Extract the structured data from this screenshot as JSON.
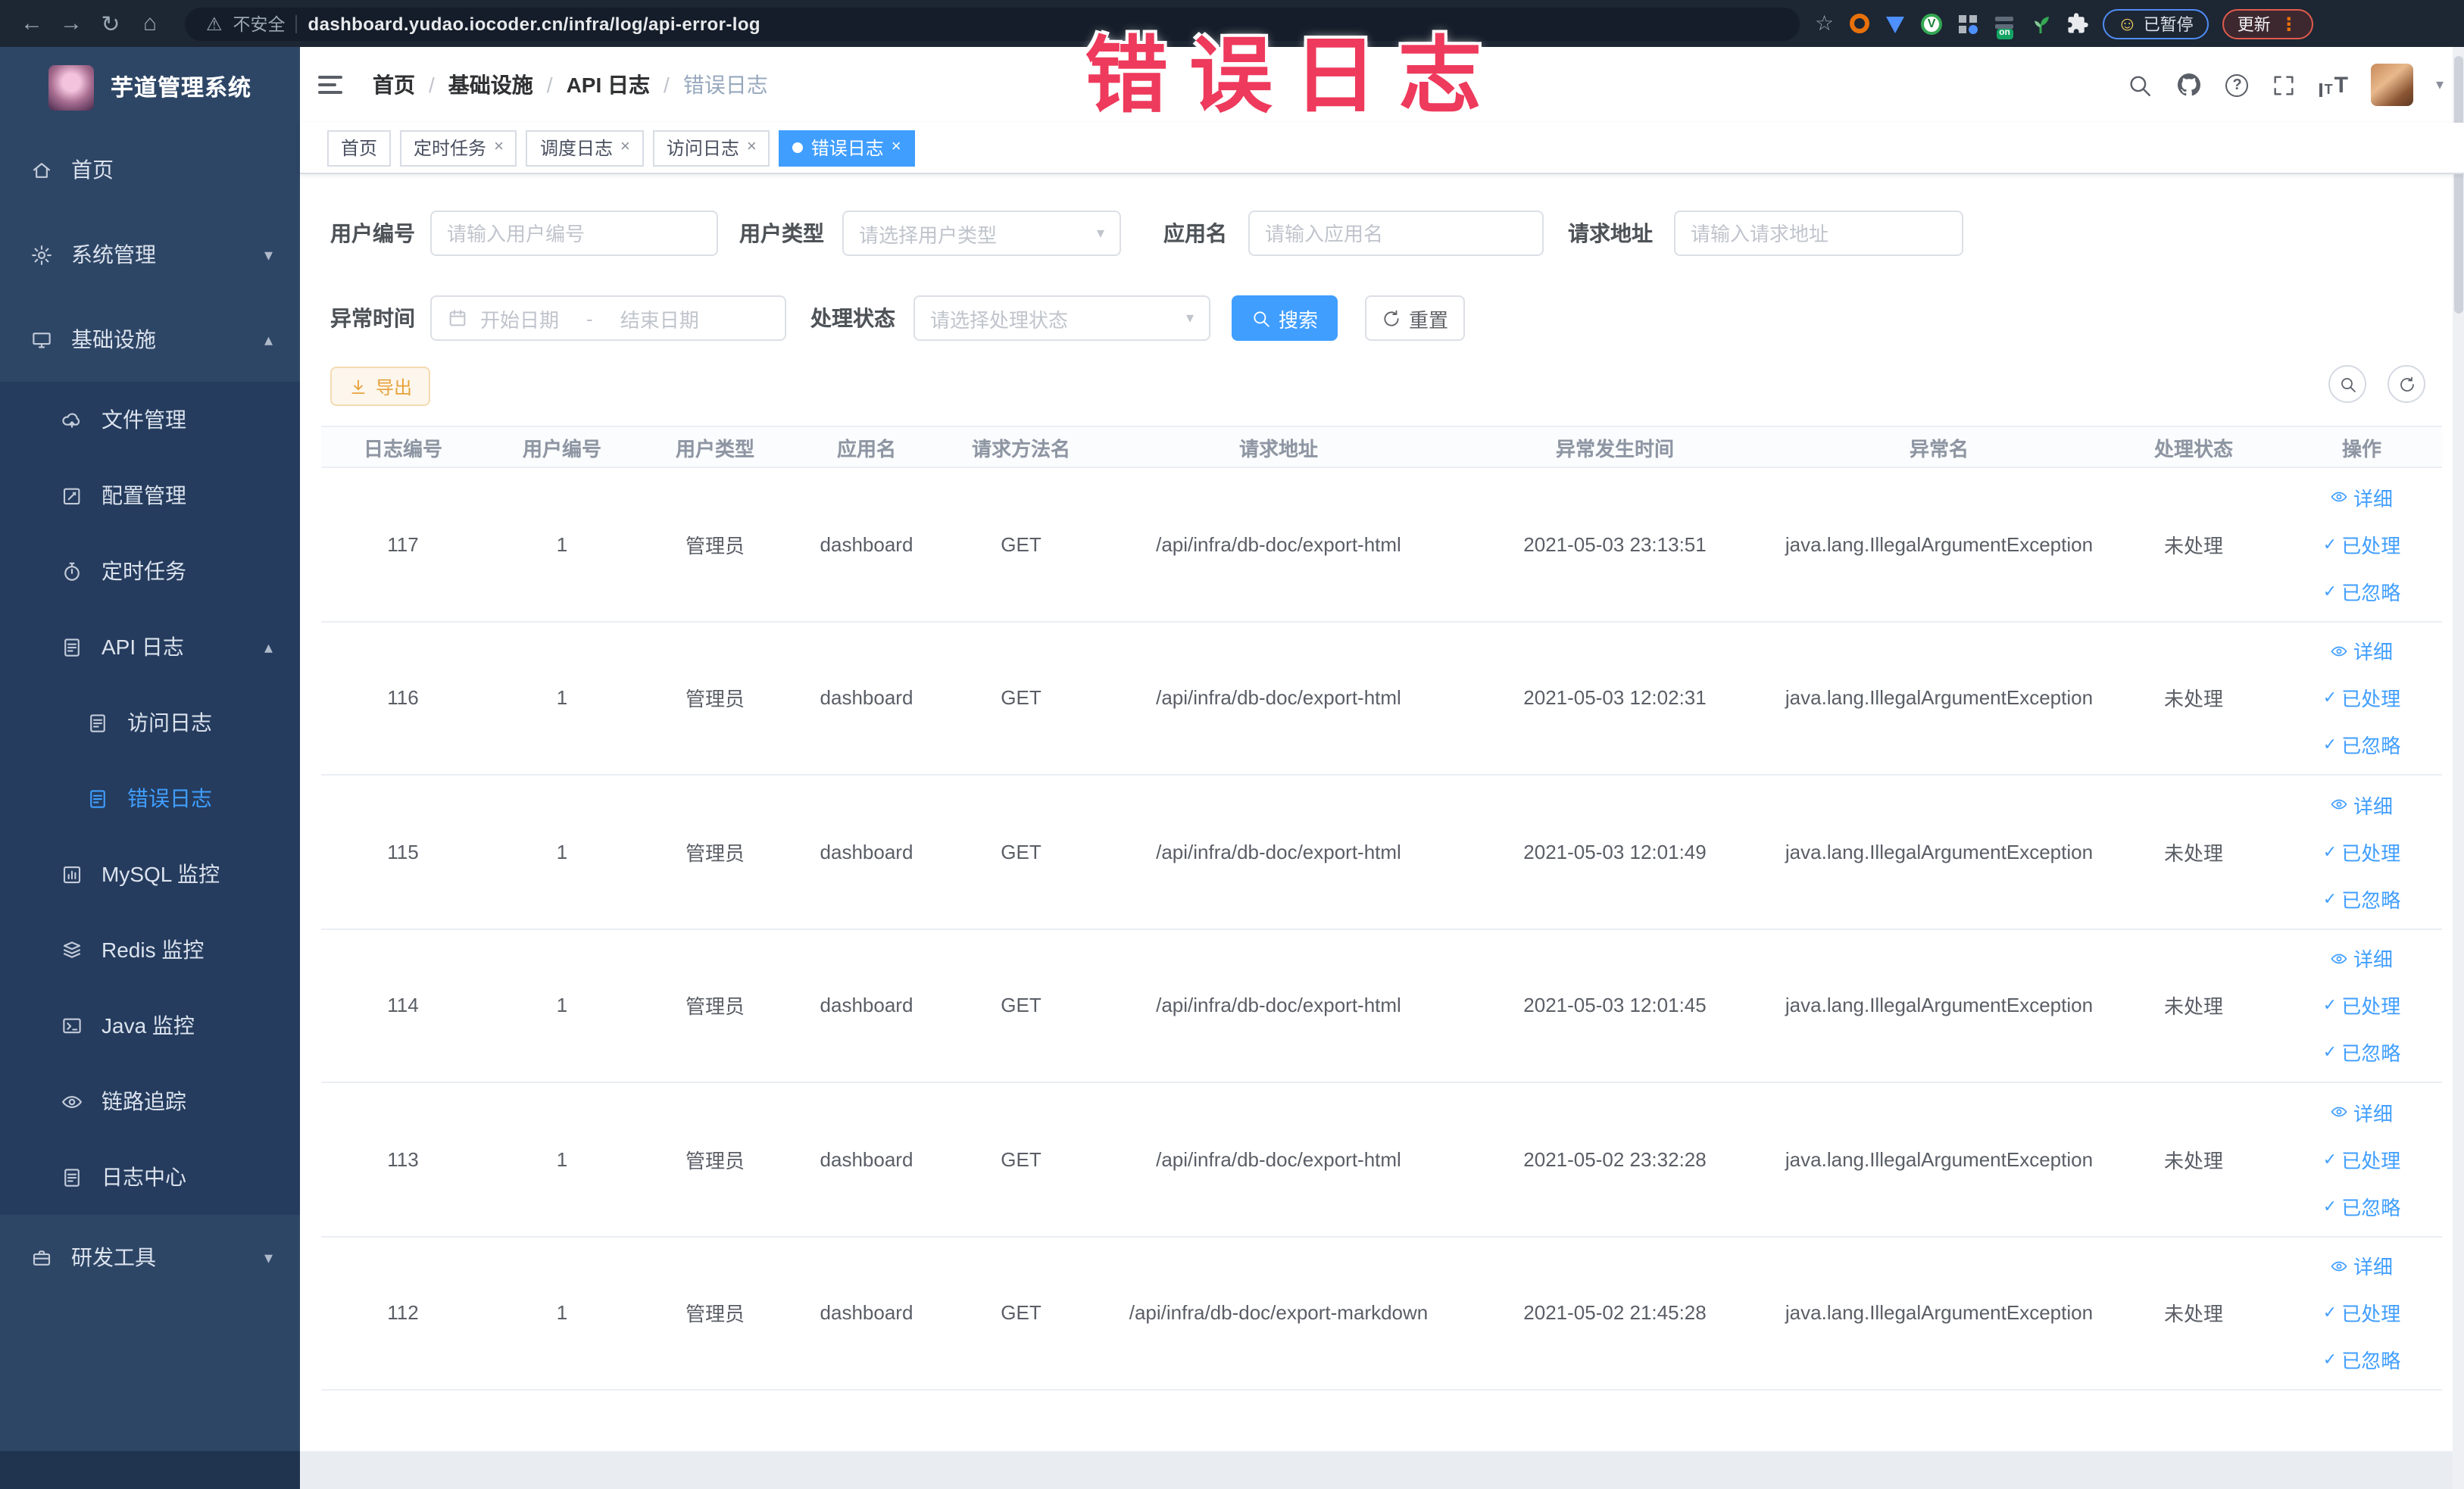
{
  "browser": {
    "security_label": "不安全",
    "url": "dashboard.yudao.iocoder.cn/infra/log/api-error-log",
    "paused_badge": "已暂停",
    "update_badge": "更新"
  },
  "overlay_title": "错误日志",
  "sidebar": {
    "title": "芋道管理系统",
    "menu": [
      {
        "label": "首页",
        "icon": "home",
        "level": 0,
        "sub": false,
        "active": false,
        "chevron": ""
      },
      {
        "label": "系统管理",
        "icon": "gear",
        "level": 0,
        "sub": false,
        "active": false,
        "chevron": "down"
      },
      {
        "label": "基础设施",
        "icon": "monitor",
        "level": 0,
        "sub": false,
        "active": false,
        "chevron": "up"
      },
      {
        "label": "文件管理",
        "icon": "cloud",
        "level": 1,
        "sub": true,
        "active": false,
        "chevron": ""
      },
      {
        "label": "配置管理",
        "icon": "edit",
        "level": 1,
        "sub": true,
        "active": false,
        "chevron": ""
      },
      {
        "label": "定时任务",
        "icon": "timer",
        "level": 1,
        "sub": true,
        "active": false,
        "chevron": ""
      },
      {
        "label": "API 日志",
        "icon": "doc",
        "level": 1,
        "sub": true,
        "active": false,
        "chevron": "up"
      },
      {
        "label": "访问日志",
        "icon": "doc",
        "level": 2,
        "sub": true,
        "active": false,
        "chevron": ""
      },
      {
        "label": "错误日志",
        "icon": "doc",
        "level": 2,
        "sub": true,
        "active": true,
        "chevron": ""
      },
      {
        "label": "MySQL 监控",
        "icon": "chart",
        "level": 1,
        "sub": true,
        "active": false,
        "chevron": ""
      },
      {
        "label": "Redis 监控",
        "icon": "layers",
        "level": 1,
        "sub": true,
        "active": false,
        "chevron": ""
      },
      {
        "label": "Java 监控",
        "icon": "java",
        "level": 1,
        "sub": true,
        "active": false,
        "chevron": ""
      },
      {
        "label": "链路追踪",
        "icon": "eye",
        "level": 1,
        "sub": true,
        "active": false,
        "chevron": ""
      },
      {
        "label": "日志中心",
        "icon": "doc",
        "level": 1,
        "sub": true,
        "active": false,
        "chevron": ""
      },
      {
        "label": "研发工具",
        "icon": "tool",
        "level": 0,
        "sub": false,
        "active": false,
        "chevron": "down"
      }
    ]
  },
  "breadcrumb": {
    "items": [
      "首页",
      "基础设施",
      "API 日志",
      "错误日志"
    ],
    "separator": "/"
  },
  "tabs": [
    {
      "label": "首页",
      "closable": false,
      "active": false
    },
    {
      "label": "定时任务",
      "closable": true,
      "active": false
    },
    {
      "label": "调度日志",
      "closable": true,
      "active": false
    },
    {
      "label": "访问日志",
      "closable": true,
      "active": false
    },
    {
      "label": "错误日志",
      "closable": true,
      "active": true
    }
  ],
  "filters": {
    "user_id": {
      "label": "用户编号",
      "placeholder": "请输入用户编号"
    },
    "user_type": {
      "label": "用户类型",
      "placeholder": "请选择用户类型"
    },
    "app_name": {
      "label": "应用名",
      "placeholder": "请输入应用名"
    },
    "request_url": {
      "label": "请求地址",
      "placeholder": "请输入请求地址"
    },
    "exception_time": {
      "label": "异常时间",
      "start_placeholder": "开始日期",
      "separator": "-",
      "end_placeholder": "结束日期"
    },
    "process_status": {
      "label": "处理状态",
      "placeholder": "请选择处理状态"
    },
    "search_label": "搜索",
    "reset_label": "重置"
  },
  "toolbar": {
    "export_label": "导出"
  },
  "table": {
    "columns": [
      "日志编号",
      "用户编号",
      "用户类型",
      "应用名",
      "请求方法名",
      "请求地址",
      "异常发生时间",
      "异常名",
      "处理状态",
      "操作"
    ],
    "actions": [
      "详细",
      "已处理",
      "已忽略"
    ],
    "rows": [
      {
        "id": "117",
        "user_id": "1",
        "user_type": "管理员",
        "app": "dashboard",
        "method": "GET",
        "url": "/api/infra/db-doc/export-html",
        "time": "2021-05-03 23:13:51",
        "exception": "java.lang.IllegalArgumentException",
        "status": "未处理"
      },
      {
        "id": "116",
        "user_id": "1",
        "user_type": "管理员",
        "app": "dashboard",
        "method": "GET",
        "url": "/api/infra/db-doc/export-html",
        "time": "2021-05-03 12:02:31",
        "exception": "java.lang.IllegalArgumentException",
        "status": "未处理"
      },
      {
        "id": "115",
        "user_id": "1",
        "user_type": "管理员",
        "app": "dashboard",
        "method": "GET",
        "url": "/api/infra/db-doc/export-html",
        "time": "2021-05-03 12:01:49",
        "exception": "java.lang.IllegalArgumentException",
        "status": "未处理"
      },
      {
        "id": "114",
        "user_id": "1",
        "user_type": "管理员",
        "app": "dashboard",
        "method": "GET",
        "url": "/api/infra/db-doc/export-html",
        "time": "2021-05-03 12:01:45",
        "exception": "java.lang.IllegalArgumentException",
        "status": "未处理"
      },
      {
        "id": "113",
        "user_id": "1",
        "user_type": "管理员",
        "app": "dashboard",
        "method": "GET",
        "url": "/api/infra/db-doc/export-html",
        "time": "2021-05-02 23:32:28",
        "exception": "java.lang.IllegalArgumentException",
        "status": "未处理"
      },
      {
        "id": "112",
        "user_id": "1",
        "user_type": "管理员",
        "app": "dashboard",
        "method": "GET",
        "url": "/api/infra/db-doc/export-markdown",
        "time": "2021-05-02 21:45:28",
        "exception": "java.lang.IllegalArgumentException",
        "status": "未处理"
      }
    ]
  },
  "colors": {
    "primary": "#409eff",
    "warning": "#e6a23c",
    "overlay_title": "#ee3a5c",
    "sidebar_bg": "#2e4666"
  }
}
